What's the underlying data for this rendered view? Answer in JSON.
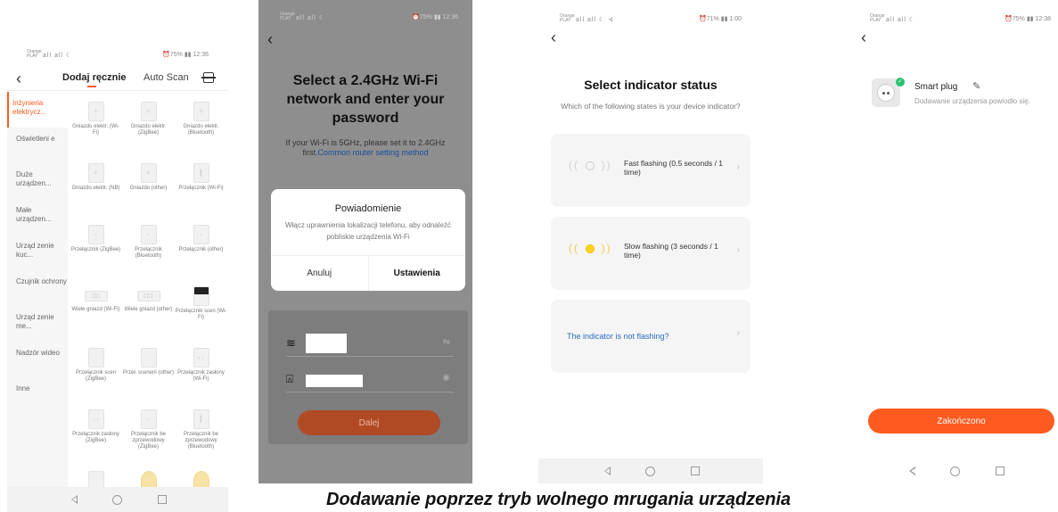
{
  "phone1": {
    "status": {
      "operator": "Orange PLAY",
      "signal": "all all ☾",
      "right": "⏰75% ▮▮ 12:36"
    },
    "tabs": {
      "manual": "Dodaj ręcznie",
      "auto": "Auto Scan"
    },
    "sidebar": [
      {
        "label": "Inżynieria elektrycz..."
      },
      {
        "label": "Oświetleni e"
      },
      {
        "label": "Duże urządzen..."
      },
      {
        "label": "Małe urządzen..."
      },
      {
        "label": "Urząd zenie kuc..."
      },
      {
        "label": "Czujnik ochrony"
      },
      {
        "label": "Urząd zenie me..."
      },
      {
        "label": "Nadzór wideo"
      },
      {
        "label": "Inne"
      }
    ],
    "devices": [
      {
        "label": "Gniazdo elektr. (Wi-Fi)"
      },
      {
        "label": "Gniazdo elektr. (ZigBee)"
      },
      {
        "label": "Gniazdo elektr. (Bluetooth)"
      },
      {
        "label": "Gniazdo elektr. (NB)"
      },
      {
        "label": "Gniazdo (other)"
      },
      {
        "label": "Przełącznik (Wi-Fi)"
      },
      {
        "label": "Przełącznik (ZigBee)"
      },
      {
        "label": "Przełącznik (Bluetooth)"
      },
      {
        "label": "Przełącznik (other)"
      },
      {
        "label": "Wiele gniazd (Wi-Fi)"
      },
      {
        "label": "Wiele gniazd (other)"
      },
      {
        "label": "Przełącznik scen (Wi-Fi)"
      },
      {
        "label": "Przełącznik scen (ZigBee)"
      },
      {
        "label": "Przeł. scenerii (other)"
      },
      {
        "label": "Przełącznik zasłony (Wi-Fi)"
      },
      {
        "label": "Przełącznik zasłony (ZigBee)"
      },
      {
        "label": "Przełącznik be zprzewodowy (ZigBee)"
      },
      {
        "label": "Przełącznik be zprzewodowy (Bluetooth)"
      },
      {
        "label": ""
      },
      {
        "label": ""
      },
      {
        "label": ""
      }
    ]
  },
  "phone2": {
    "status": {
      "operator": "Orange PLAY",
      "signal": "all all ☾",
      "right": "⏰75% ▮▮ 12:36"
    },
    "title": "Select a 2.4GHz Wi-Fi network and enter your password",
    "hint": "If your Wi-Fi is 5GHz, please set it to 2.4GHz first.",
    "hint_link": "Common router setting method",
    "dialog": {
      "title": "Powiadomienie",
      "body": "Włącz uprawnienia lokalizacji telefonu, aby odnaleźć pobliskie urządzenia Wi-Fi",
      "cancel": "Anuluj",
      "settings": "Ustawienia"
    },
    "next": "Dalej"
  },
  "phone3": {
    "status": {
      "operator": "Orange PLAY",
      "signal": "all all ☾ ⊰",
      "right": "⏰71% ▮▮ 1:00"
    },
    "title": "Select indicator status",
    "subtitle": "Which of the following states is your device indicator?",
    "options": [
      {
        "label": "Fast flashing (0.5 seconds / 1 time)"
      },
      {
        "label": "Slow flashing (3 seconds / 1 time)"
      },
      {
        "label": "The indicator is not flashing?"
      }
    ]
  },
  "phone4": {
    "status": {
      "operator": "Orange PLAY",
      "signal": "all all ☾",
      "right": "⏰75% ▮▮ 12:38"
    },
    "device_name": "Smart plug",
    "device_status": "Dodawanie urządzenia powiodło się.",
    "done": "Zakończono"
  },
  "caption": "Dodawanie poprzez tryb wolnego mrugania urządzenia",
  "colors": {
    "accent": "#ff5a1f",
    "success": "#27c26c",
    "link": "#2a6fc0"
  }
}
